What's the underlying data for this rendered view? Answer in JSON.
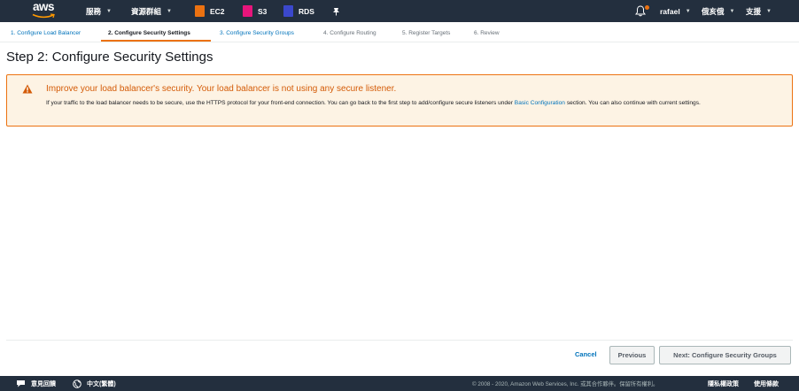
{
  "topnav": {
    "logo_text": "aws",
    "services_label": "服務",
    "resource_groups_label": "資源群組",
    "pins": [
      {
        "label": "EC2",
        "color": "#ec7211"
      },
      {
        "label": "S3",
        "color": "#e7157b"
      },
      {
        "label": "RDS",
        "color": "#3b48cc"
      }
    ],
    "user_label": "rafael",
    "region_label": "俄亥俄",
    "support_label": "支援"
  },
  "steps": [
    {
      "label": "1. Configure Load Balancer",
      "state": "done"
    },
    {
      "label": "2. Configure Security Settings",
      "state": "active"
    },
    {
      "label": "3. Configure Security Groups",
      "state": "done"
    },
    {
      "label": "4. Configure Routing",
      "state": "future"
    },
    {
      "label": "5. Register Targets",
      "state": "future"
    },
    {
      "label": "6. Review",
      "state": "future"
    }
  ],
  "page_title": "Step 2: Configure Security Settings",
  "alert": {
    "title": "Improve your load balancer's security. Your load balancer is not using any secure listener.",
    "body_before_link": "If your traffic to the load balancer needs to be secure, use the HTTPS protocol for your front-end connection. You can go back to the first step to add/configure secure listeners under ",
    "link": "Basic Configuration",
    "body_after_link": " section. You can also continue with current settings.",
    "accent_color": "#ec7211"
  },
  "buttons": {
    "cancel": "Cancel",
    "previous": "Previous",
    "next": "Next: Configure Security Groups"
  },
  "bottombar": {
    "feedback_label": "意見回饋",
    "language_label": "中文(繁體)",
    "copyright": "© 2008 - 2020, Amazon Web Services, Inc. 或其合作夥伴。保留所有權利。",
    "privacy_label": "隱私權政策",
    "terms_label": "使用條款"
  }
}
